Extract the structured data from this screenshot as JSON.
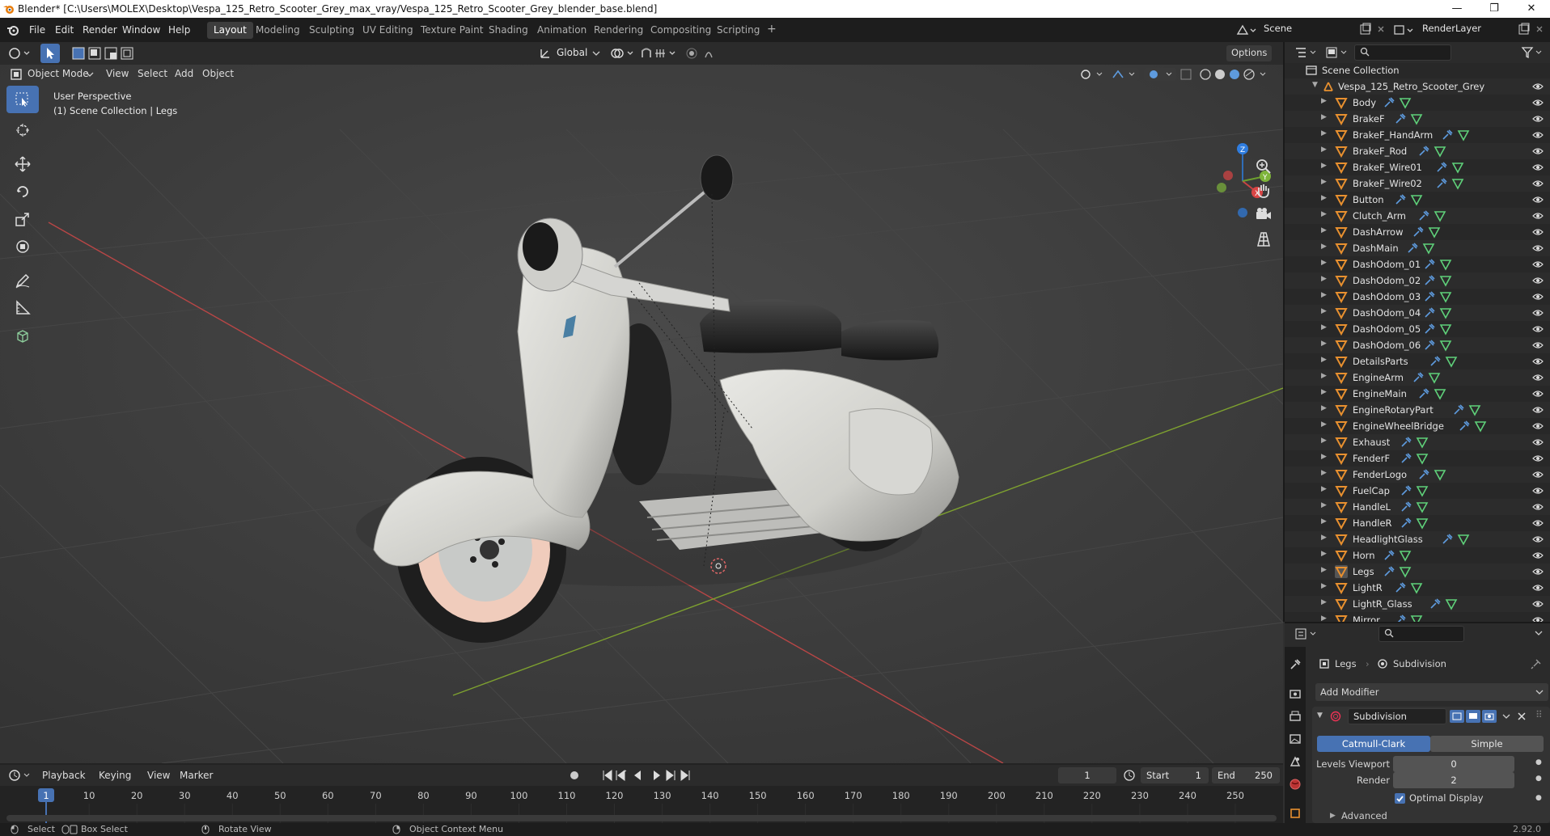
{
  "window": {
    "title": "Blender* [C:\\Users\\MOLEX\\Desktop\\Vespa_125_Retro_Scooter_Grey_max_vray/Vespa_125_Retro_Scooter_Grey_blender_base.blend]",
    "minimize": "—",
    "maximize": "❐",
    "close": "✕"
  },
  "menu": [
    "File",
    "Edit",
    "Render",
    "Window",
    "Help"
  ],
  "workspaces": [
    "Layout",
    "Modeling",
    "Sculpting",
    "UV Editing",
    "Texture Paint",
    "Shading",
    "Animation",
    "Rendering",
    "Compositing",
    "Scripting"
  ],
  "workspace_add": "+",
  "scene": {
    "label": "Scene",
    "view_layer": "RenderLayer"
  },
  "viewport_header": {
    "transform_orientation": "Global",
    "options": "Options",
    "mode": "Object Mode",
    "menus": [
      "View",
      "Select",
      "Add",
      "Object"
    ]
  },
  "viewport_overlay": {
    "line1": "User Perspective",
    "line2": "(1) Scene Collection | Legs"
  },
  "gizmo": {
    "x": "X",
    "y": "Y",
    "z": "Z"
  },
  "outliner": {
    "root": "Scene Collection",
    "collection": "Vespa_125_Retro_Scooter_Grey",
    "objects": [
      "Body",
      "BrakeF",
      "BrakeF_HandArm",
      "BrakeF_Rod",
      "BrakeF_Wire01",
      "BrakeF_Wire02",
      "Button",
      "Clutch_Arm",
      "DashArrow",
      "DashMain",
      "DashOdom_01",
      "DashOdom_02",
      "DashOdom_03",
      "DashOdom_04",
      "DashOdom_05",
      "DashOdom_06",
      "DetailsParts",
      "EngineArm",
      "EngineMain",
      "EngineRotaryPart",
      "EngineWheelBridge",
      "Exhaust",
      "FenderF",
      "FenderLogo",
      "FuelCap",
      "HandleL",
      "HandleR",
      "HeadlightGlass",
      "Horn",
      "Legs",
      "LightR",
      "LightR_Glass",
      "Mirror"
    ],
    "active": "Legs"
  },
  "properties": {
    "object": "Legs",
    "modifier_breadcrumb": "Subdivision",
    "add_modifier": "Add Modifier",
    "modifier_name": "Subdivision",
    "mode_a": "Catmull-Clark",
    "mode_b": "Simple",
    "levels_viewport_label": "Levels Viewport",
    "levels_viewport": "0",
    "render_label": "Render",
    "render_value": "2",
    "optimal_display": "Optimal Display",
    "optimal_display_checked": true,
    "advanced": "Advanced"
  },
  "timeline": {
    "menus": [
      "Playback",
      "Keying",
      "View",
      "Marker"
    ],
    "current_frame": "1",
    "start_label": "Start",
    "start": "1",
    "end_label": "End",
    "end": "250",
    "ruler": [
      "1",
      "10",
      "20",
      "30",
      "40",
      "50",
      "60",
      "70",
      "80",
      "90",
      "100",
      "110",
      "120",
      "130",
      "140",
      "150",
      "160",
      "170",
      "180",
      "190",
      "200",
      "210",
      "220",
      "230",
      "240",
      "250"
    ]
  },
  "statusbar": {
    "select": "Select",
    "box_select": "Box Select",
    "rotate": "Rotate View",
    "context_menu": "Object Context Menu",
    "version": "2.92.0"
  },
  "colors": {
    "accent": "#4772b3",
    "object_orange": "#e8902f",
    "modifier_blue": "#5e9bde",
    "mesh_green": "#5fd17a",
    "axis_red": "#b84646",
    "axis_green": "#7ea12f"
  }
}
